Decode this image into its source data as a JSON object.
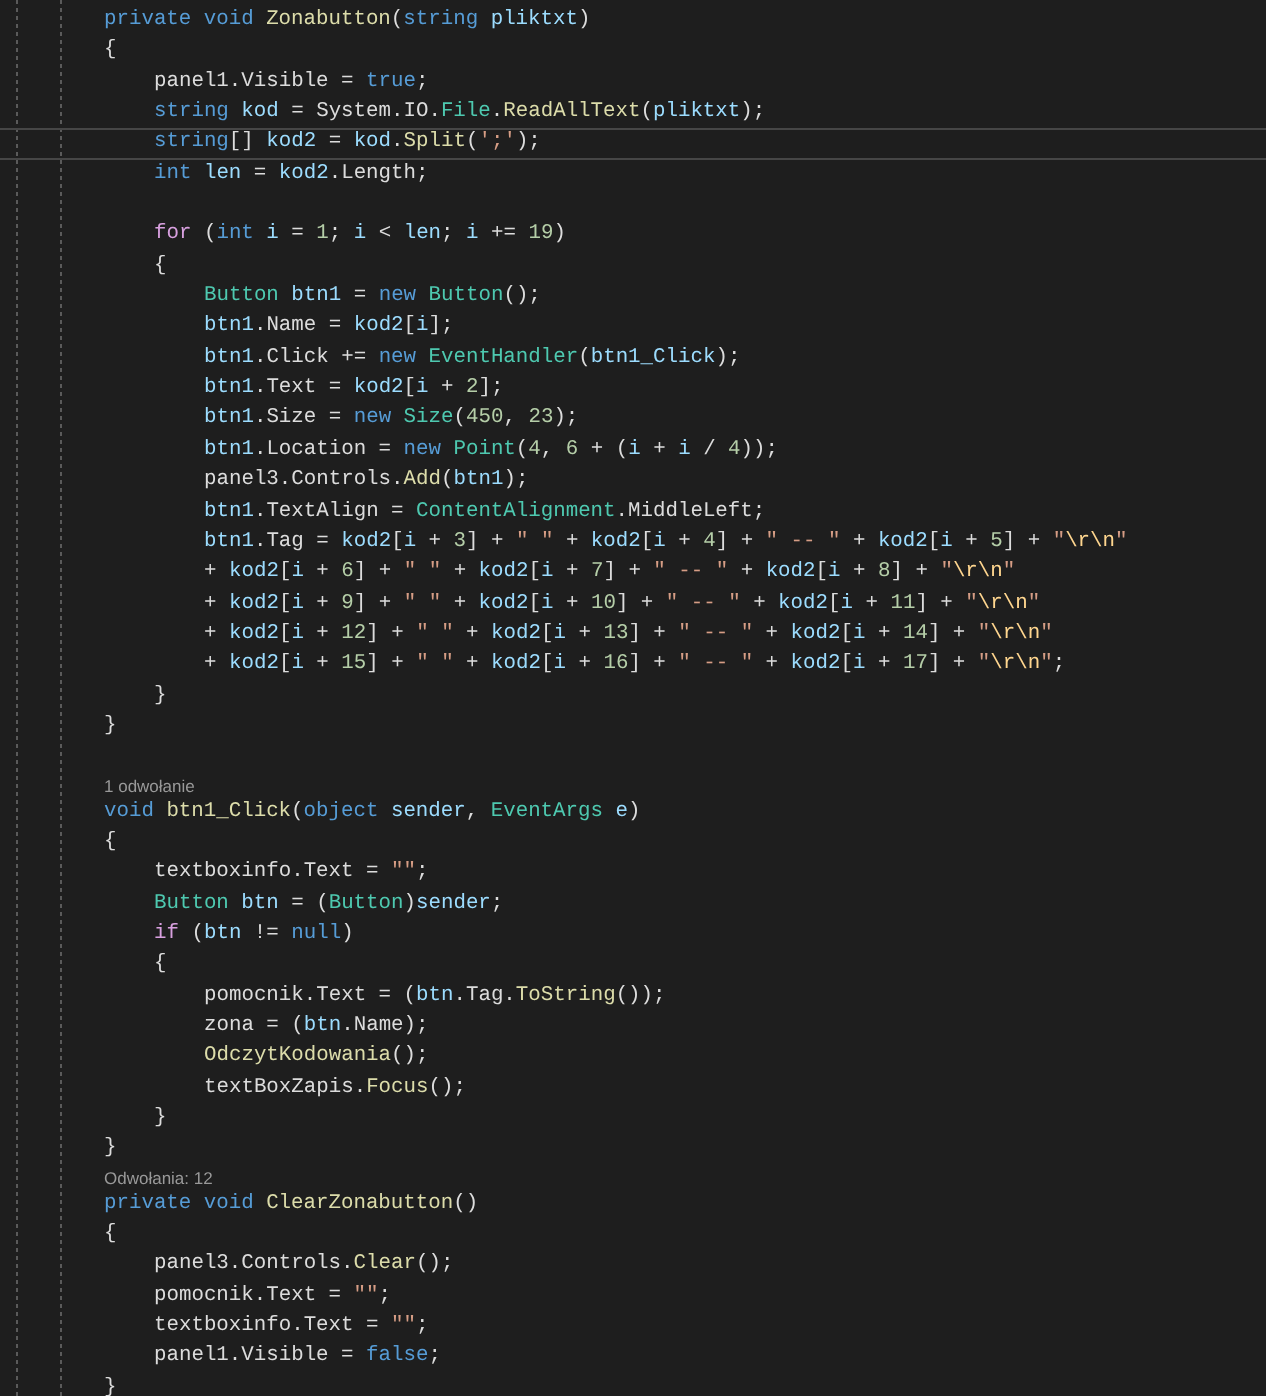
{
  "lines": [
    {
      "kind": "code",
      "current": false,
      "tokens": [
        {
          "text": "private void ",
          "kind": "kw"
        },
        {
          "text": "Zonabutton",
          "kind": "method"
        },
        {
          "text": "(",
          "kind": "p"
        },
        {
          "text": "string ",
          "kind": "kw"
        },
        {
          "text": "pliktxt",
          "kind": "var"
        },
        {
          "text": ")",
          "kind": "p"
        }
      ]
    },
    {
      "kind": "code",
      "current": false,
      "tokens": [
        {
          "text": "{",
          "kind": "p"
        }
      ],
      "children": [
        {
          "kind": "code",
          "current": false,
          "tokens": [
            {
              "text": "panel1.Visible = ",
              "kind": "p"
            },
            {
              "text": "true",
              "kind": "kw"
            },
            {
              "text": ";",
              "kind": "p"
            }
          ]
        },
        {
          "kind": "code",
          "current": false,
          "tokens": [
            {
              "text": "string ",
              "kind": "kw"
            },
            {
              "text": "kod",
              "kind": "var"
            },
            {
              "text": " = System.IO.",
              "kind": "p"
            },
            {
              "text": "File",
              "kind": "type"
            },
            {
              "text": ".",
              "kind": "p"
            },
            {
              "text": "ReadAllText",
              "kind": "method"
            },
            {
              "text": "(",
              "kind": "p"
            },
            {
              "text": "pliktxt",
              "kind": "var"
            },
            {
              "text": ");",
              "kind": "p"
            }
          ]
        },
        {
          "kind": "code",
          "current": true,
          "tokens": [
            {
              "text": "string",
              "kind": "kw"
            },
            {
              "text": "[] ",
              "kind": "p"
            },
            {
              "text": "kod2",
              "kind": "var"
            },
            {
              "text": " = ",
              "kind": "p"
            },
            {
              "text": "kod",
              "kind": "var"
            },
            {
              "text": ".",
              "kind": "p"
            },
            {
              "text": "Split",
              "kind": "method"
            },
            {
              "text": "(",
              "kind": "p"
            },
            {
              "text": "';'",
              "kind": "str"
            },
            {
              "text": ");",
              "kind": "p"
            }
          ]
        },
        {
          "kind": "code",
          "current": false,
          "tokens": [
            {
              "text": "int ",
              "kind": "kw"
            },
            {
              "text": "len",
              "kind": "var"
            },
            {
              "text": " = ",
              "kind": "p"
            },
            {
              "text": "kod2",
              "kind": "var"
            },
            {
              "text": ".Length;",
              "kind": "p"
            }
          ]
        },
        {
          "kind": "blank"
        },
        {
          "kind": "code",
          "current": false,
          "tokens": [
            {
              "text": "for",
              "kind": "ctrl"
            },
            {
              "text": " (",
              "kind": "p"
            },
            {
              "text": "int ",
              "kind": "kw"
            },
            {
              "text": "i",
              "kind": "var"
            },
            {
              "text": " = ",
              "kind": "p"
            },
            {
              "text": "1",
              "kind": "num"
            },
            {
              "text": "; ",
              "kind": "p"
            },
            {
              "text": "i",
              "kind": "var"
            },
            {
              "text": " < ",
              "kind": "p"
            },
            {
              "text": "len",
              "kind": "var"
            },
            {
              "text": "; ",
              "kind": "p"
            },
            {
              "text": "i",
              "kind": "var"
            },
            {
              "text": " += ",
              "kind": "p"
            },
            {
              "text": "19",
              "kind": "num"
            },
            {
              "text": ")",
              "kind": "p"
            }
          ]
        },
        {
          "kind": "code",
          "current": false,
          "tokens": [
            {
              "text": "{",
              "kind": "p"
            }
          ],
          "children": [
            {
              "kind": "code",
              "current": false,
              "tokens": [
                {
                  "text": "Button ",
                  "kind": "type"
                },
                {
                  "text": "btn1",
                  "kind": "var"
                },
                {
                  "text": " = ",
                  "kind": "p"
                },
                {
                  "text": "new ",
                  "kind": "kw"
                },
                {
                  "text": "Button",
                  "kind": "type"
                },
                {
                  "text": "();",
                  "kind": "p"
                }
              ]
            },
            {
              "kind": "code",
              "current": false,
              "tokens": [
                {
                  "text": "btn1",
                  "kind": "var"
                },
                {
                  "text": ".Name = ",
                  "kind": "p"
                },
                {
                  "text": "kod2",
                  "kind": "var"
                },
                {
                  "text": "[",
                  "kind": "p"
                },
                {
                  "text": "i",
                  "kind": "var"
                },
                {
                  "text": "];",
                  "kind": "p"
                }
              ]
            },
            {
              "kind": "code",
              "current": false,
              "tokens": [
                {
                  "text": "btn1",
                  "kind": "var"
                },
                {
                  "text": ".Click += ",
                  "kind": "p"
                },
                {
                  "text": "new ",
                  "kind": "kw"
                },
                {
                  "text": "EventHandler",
                  "kind": "type"
                },
                {
                  "text": "(",
                  "kind": "p"
                },
                {
                  "text": "btn1_Click",
                  "kind": "var"
                },
                {
                  "text": ");",
                  "kind": "p"
                }
              ]
            },
            {
              "kind": "code",
              "current": false,
              "tokens": [
                {
                  "text": "btn1",
                  "kind": "var"
                },
                {
                  "text": ".Text = ",
                  "kind": "p"
                },
                {
                  "text": "kod2",
                  "kind": "var"
                },
                {
                  "text": "[",
                  "kind": "p"
                },
                {
                  "text": "i",
                  "kind": "var"
                },
                {
                  "text": " + ",
                  "kind": "p"
                },
                {
                  "text": "2",
                  "kind": "num"
                },
                {
                  "text": "];",
                  "kind": "p"
                }
              ]
            },
            {
              "kind": "code",
              "current": false,
              "tokens": [
                {
                  "text": "btn1",
                  "kind": "var"
                },
                {
                  "text": ".Size = ",
                  "kind": "p"
                },
                {
                  "text": "new ",
                  "kind": "kw"
                },
                {
                  "text": "Size",
                  "kind": "type"
                },
                {
                  "text": "(",
                  "kind": "p"
                },
                {
                  "text": "450",
                  "kind": "num"
                },
                {
                  "text": ", ",
                  "kind": "p"
                },
                {
                  "text": "23",
                  "kind": "num"
                },
                {
                  "text": ");",
                  "kind": "p"
                }
              ]
            },
            {
              "kind": "code",
              "current": false,
              "tokens": [
                {
                  "text": "btn1",
                  "kind": "var"
                },
                {
                  "text": ".Location = ",
                  "kind": "p"
                },
                {
                  "text": "new ",
                  "kind": "kw"
                },
                {
                  "text": "Point",
                  "kind": "type"
                },
                {
                  "text": "(",
                  "kind": "p"
                },
                {
                  "text": "4",
                  "kind": "num"
                },
                {
                  "text": ", ",
                  "kind": "p"
                },
                {
                  "text": "6",
                  "kind": "num"
                },
                {
                  "text": " + (",
                  "kind": "p"
                },
                {
                  "text": "i",
                  "kind": "var"
                },
                {
                  "text": " + ",
                  "kind": "p"
                },
                {
                  "text": "i",
                  "kind": "var"
                },
                {
                  "text": " / ",
                  "kind": "p"
                },
                {
                  "text": "4",
                  "kind": "num"
                },
                {
                  "text": "));",
                  "kind": "p"
                }
              ]
            },
            {
              "kind": "code",
              "current": false,
              "tokens": [
                {
                  "text": "panel3.Controls.",
                  "kind": "p"
                },
                {
                  "text": "Add",
                  "kind": "method"
                },
                {
                  "text": "(",
                  "kind": "p"
                },
                {
                  "text": "btn1",
                  "kind": "var"
                },
                {
                  "text": ");",
                  "kind": "p"
                }
              ]
            },
            {
              "kind": "code",
              "current": false,
              "tokens": [
                {
                  "text": "btn1",
                  "kind": "var"
                },
                {
                  "text": ".TextAlign = ",
                  "kind": "p"
                },
                {
                  "text": "ContentAlignment",
                  "kind": "type"
                },
                {
                  "text": ".MiddleLeft;",
                  "kind": "p"
                }
              ]
            },
            {
              "kind": "code",
              "current": false,
              "tokens": [
                {
                  "text": "btn1",
                  "kind": "var"
                },
                {
                  "text": ".Tag = ",
                  "kind": "p"
                },
                {
                  "text": "kod2",
                  "kind": "var"
                },
                {
                  "text": "[",
                  "kind": "p"
                },
                {
                  "text": "i",
                  "kind": "var"
                },
                {
                  "text": " + ",
                  "kind": "p"
                },
                {
                  "text": "3",
                  "kind": "num"
                },
                {
                  "text": "] + ",
                  "kind": "p"
                },
                {
                  "text": "\" \"",
                  "kind": "str"
                },
                {
                  "text": " + ",
                  "kind": "p"
                },
                {
                  "text": "kod2",
                  "kind": "var"
                },
                {
                  "text": "[",
                  "kind": "p"
                },
                {
                  "text": "i",
                  "kind": "var"
                },
                {
                  "text": " + ",
                  "kind": "p"
                },
                {
                  "text": "4",
                  "kind": "num"
                },
                {
                  "text": "] + ",
                  "kind": "p"
                },
                {
                  "text": "\" -- \"",
                  "kind": "str"
                },
                {
                  "text": " + ",
                  "kind": "p"
                },
                {
                  "text": "kod2",
                  "kind": "var"
                },
                {
                  "text": "[",
                  "kind": "p"
                },
                {
                  "text": "i",
                  "kind": "var"
                },
                {
                  "text": " + ",
                  "kind": "p"
                },
                {
                  "text": "5",
                  "kind": "num"
                },
                {
                  "text": "] + ",
                  "kind": "p"
                },
                {
                  "text": "\"",
                  "kind": "str"
                },
                {
                  "text": "\\r\\n",
                  "kind": "esc"
                },
                {
                  "text": "\"",
                  "kind": "str"
                }
              ]
            },
            {
              "kind": "code",
              "current": false,
              "tokens": [
                {
                  "text": "+ ",
                  "kind": "p"
                },
                {
                  "text": "kod2",
                  "kind": "var"
                },
                {
                  "text": "[",
                  "kind": "p"
                },
                {
                  "text": "i",
                  "kind": "var"
                },
                {
                  "text": " + ",
                  "kind": "p"
                },
                {
                  "text": "6",
                  "kind": "num"
                },
                {
                  "text": "] + ",
                  "kind": "p"
                },
                {
                  "text": "\" \"",
                  "kind": "str"
                },
                {
                  "text": " + ",
                  "kind": "p"
                },
                {
                  "text": "kod2",
                  "kind": "var"
                },
                {
                  "text": "[",
                  "kind": "p"
                },
                {
                  "text": "i",
                  "kind": "var"
                },
                {
                  "text": " + ",
                  "kind": "p"
                },
                {
                  "text": "7",
                  "kind": "num"
                },
                {
                  "text": "] + ",
                  "kind": "p"
                },
                {
                  "text": "\" -- \"",
                  "kind": "str"
                },
                {
                  "text": " + ",
                  "kind": "p"
                },
                {
                  "text": "kod2",
                  "kind": "var"
                },
                {
                  "text": "[",
                  "kind": "p"
                },
                {
                  "text": "i",
                  "kind": "var"
                },
                {
                  "text": " + ",
                  "kind": "p"
                },
                {
                  "text": "8",
                  "kind": "num"
                },
                {
                  "text": "] + ",
                  "kind": "p"
                },
                {
                  "text": "\"",
                  "kind": "str"
                },
                {
                  "text": "\\r\\n",
                  "kind": "esc"
                },
                {
                  "text": "\"",
                  "kind": "str"
                }
              ]
            },
            {
              "kind": "code",
              "current": false,
              "tokens": [
                {
                  "text": "+ ",
                  "kind": "p"
                },
                {
                  "text": "kod2",
                  "kind": "var"
                },
                {
                  "text": "[",
                  "kind": "p"
                },
                {
                  "text": "i",
                  "kind": "var"
                },
                {
                  "text": " + ",
                  "kind": "p"
                },
                {
                  "text": "9",
                  "kind": "num"
                },
                {
                  "text": "] + ",
                  "kind": "p"
                },
                {
                  "text": "\" \"",
                  "kind": "str"
                },
                {
                  "text": " + ",
                  "kind": "p"
                },
                {
                  "text": "kod2",
                  "kind": "var"
                },
                {
                  "text": "[",
                  "kind": "p"
                },
                {
                  "text": "i",
                  "kind": "var"
                },
                {
                  "text": " + ",
                  "kind": "p"
                },
                {
                  "text": "10",
                  "kind": "num"
                },
                {
                  "text": "] + ",
                  "kind": "p"
                },
                {
                  "text": "\" -- \"",
                  "kind": "str"
                },
                {
                  "text": " + ",
                  "kind": "p"
                },
                {
                  "text": "kod2",
                  "kind": "var"
                },
                {
                  "text": "[",
                  "kind": "p"
                },
                {
                  "text": "i",
                  "kind": "var"
                },
                {
                  "text": " + ",
                  "kind": "p"
                },
                {
                  "text": "11",
                  "kind": "num"
                },
                {
                  "text": "] + ",
                  "kind": "p"
                },
                {
                  "text": "\"",
                  "kind": "str"
                },
                {
                  "text": "\\r\\n",
                  "kind": "esc"
                },
                {
                  "text": "\"",
                  "kind": "str"
                }
              ]
            },
            {
              "kind": "code",
              "current": false,
              "tokens": [
                {
                  "text": "+ ",
                  "kind": "p"
                },
                {
                  "text": "kod2",
                  "kind": "var"
                },
                {
                  "text": "[",
                  "kind": "p"
                },
                {
                  "text": "i",
                  "kind": "var"
                },
                {
                  "text": " + ",
                  "kind": "p"
                },
                {
                  "text": "12",
                  "kind": "num"
                },
                {
                  "text": "] + ",
                  "kind": "p"
                },
                {
                  "text": "\" \"",
                  "kind": "str"
                },
                {
                  "text": " + ",
                  "kind": "p"
                },
                {
                  "text": "kod2",
                  "kind": "var"
                },
                {
                  "text": "[",
                  "kind": "p"
                },
                {
                  "text": "i",
                  "kind": "var"
                },
                {
                  "text": " + ",
                  "kind": "p"
                },
                {
                  "text": "13",
                  "kind": "num"
                },
                {
                  "text": "] + ",
                  "kind": "p"
                },
                {
                  "text": "\" -- \"",
                  "kind": "str"
                },
                {
                  "text": " + ",
                  "kind": "p"
                },
                {
                  "text": "kod2",
                  "kind": "var"
                },
                {
                  "text": "[",
                  "kind": "p"
                },
                {
                  "text": "i",
                  "kind": "var"
                },
                {
                  "text": " + ",
                  "kind": "p"
                },
                {
                  "text": "14",
                  "kind": "num"
                },
                {
                  "text": "] + ",
                  "kind": "p"
                },
                {
                  "text": "\"",
                  "kind": "str"
                },
                {
                  "text": "\\r\\n",
                  "kind": "esc"
                },
                {
                  "text": "\"",
                  "kind": "str"
                }
              ]
            },
            {
              "kind": "code",
              "current": false,
              "tokens": [
                {
                  "text": "+ ",
                  "kind": "p"
                },
                {
                  "text": "kod2",
                  "kind": "var"
                },
                {
                  "text": "[",
                  "kind": "p"
                },
                {
                  "text": "i",
                  "kind": "var"
                },
                {
                  "text": " + ",
                  "kind": "p"
                },
                {
                  "text": "15",
                  "kind": "num"
                },
                {
                  "text": "] + ",
                  "kind": "p"
                },
                {
                  "text": "\" \"",
                  "kind": "str"
                },
                {
                  "text": " + ",
                  "kind": "p"
                },
                {
                  "text": "kod2",
                  "kind": "var"
                },
                {
                  "text": "[",
                  "kind": "p"
                },
                {
                  "text": "i",
                  "kind": "var"
                },
                {
                  "text": " + ",
                  "kind": "p"
                },
                {
                  "text": "16",
                  "kind": "num"
                },
                {
                  "text": "] + ",
                  "kind": "p"
                },
                {
                  "text": "\" -- \"",
                  "kind": "str"
                },
                {
                  "text": " + ",
                  "kind": "p"
                },
                {
                  "text": "kod2",
                  "kind": "var"
                },
                {
                  "text": "[",
                  "kind": "p"
                },
                {
                  "text": "i",
                  "kind": "var"
                },
                {
                  "text": " + ",
                  "kind": "p"
                },
                {
                  "text": "17",
                  "kind": "num"
                },
                {
                  "text": "] + ",
                  "kind": "p"
                },
                {
                  "text": "\"",
                  "kind": "str"
                },
                {
                  "text": "\\r\\n",
                  "kind": "esc"
                },
                {
                  "text": "\"",
                  "kind": "str"
                },
                {
                  "text": ";",
                  "kind": "p"
                }
              ]
            }
          ]
        },
        {
          "kind": "code",
          "current": false,
          "tokens": [
            {
              "text": "}",
              "kind": "p"
            }
          ]
        }
      ]
    },
    {
      "kind": "code",
      "current": false,
      "tokens": [
        {
          "text": "}",
          "kind": "p"
        }
      ]
    },
    {
      "kind": "blank"
    },
    {
      "kind": "lens",
      "text": "1 odwołanie"
    },
    {
      "kind": "code",
      "current": false,
      "tokens": [
        {
          "text": "void ",
          "kind": "kw"
        },
        {
          "text": "btn1_Click",
          "kind": "method"
        },
        {
          "text": "(",
          "kind": "p"
        },
        {
          "text": "object ",
          "kind": "kw"
        },
        {
          "text": "sender",
          "kind": "var"
        },
        {
          "text": ", ",
          "kind": "p"
        },
        {
          "text": "EventArgs ",
          "kind": "type"
        },
        {
          "text": "e",
          "kind": "var"
        },
        {
          "text": ")",
          "kind": "p"
        }
      ]
    },
    {
      "kind": "code",
      "current": false,
      "tokens": [
        {
          "text": "{",
          "kind": "p"
        }
      ],
      "children": [
        {
          "kind": "code",
          "current": false,
          "tokens": [
            {
              "text": "textboxinfo.Text = ",
              "kind": "p"
            },
            {
              "text": "\"\"",
              "kind": "str"
            },
            {
              "text": ";",
              "kind": "p"
            }
          ]
        },
        {
          "kind": "code",
          "current": false,
          "tokens": [
            {
              "text": "Button ",
              "kind": "type"
            },
            {
              "text": "btn",
              "kind": "var"
            },
            {
              "text": " = (",
              "kind": "p"
            },
            {
              "text": "Button",
              "kind": "type"
            },
            {
              "text": ")",
              "kind": "p"
            },
            {
              "text": "sender",
              "kind": "var"
            },
            {
              "text": ";",
              "kind": "p"
            }
          ]
        },
        {
          "kind": "code",
          "current": false,
          "tokens": [
            {
              "text": "if",
              "kind": "ctrl"
            },
            {
              "text": " (",
              "kind": "p"
            },
            {
              "text": "btn",
              "kind": "var"
            },
            {
              "text": " != ",
              "kind": "p"
            },
            {
              "text": "null",
              "kind": "kw"
            },
            {
              "text": ")",
              "kind": "p"
            }
          ]
        },
        {
          "kind": "code",
          "current": false,
          "tokens": [
            {
              "text": "{",
              "kind": "p"
            }
          ],
          "children": [
            {
              "kind": "code",
              "current": false,
              "tokens": [
                {
                  "text": "pomocnik.Text = (",
                  "kind": "p"
                },
                {
                  "text": "btn",
                  "kind": "var"
                },
                {
                  "text": ".Tag.",
                  "kind": "p"
                },
                {
                  "text": "ToString",
                  "kind": "method"
                },
                {
                  "text": "());",
                  "kind": "p"
                }
              ]
            },
            {
              "kind": "code",
              "current": false,
              "tokens": [
                {
                  "text": "zona = (",
                  "kind": "p"
                },
                {
                  "text": "btn",
                  "kind": "var"
                },
                {
                  "text": ".Name);",
                  "kind": "p"
                }
              ]
            },
            {
              "kind": "code",
              "current": false,
              "tokens": [
                {
                  "text": "OdczytKodowania",
                  "kind": "method"
                },
                {
                  "text": "();",
                  "kind": "p"
                }
              ]
            },
            {
              "kind": "code",
              "current": false,
              "tokens": [
                {
                  "text": "textBoxZapis.",
                  "kind": "p"
                },
                {
                  "text": "Focus",
                  "kind": "method"
                },
                {
                  "text": "();",
                  "kind": "p"
                }
              ]
            }
          ]
        },
        {
          "kind": "code",
          "current": false,
          "tokens": [
            {
              "text": "}",
              "kind": "p"
            }
          ]
        }
      ]
    },
    {
      "kind": "code",
      "current": false,
      "tokens": [
        {
          "text": "}",
          "kind": "p"
        }
      ]
    },
    {
      "kind": "lens",
      "text": "Odwołania: 12"
    },
    {
      "kind": "code",
      "current": false,
      "tokens": [
        {
          "text": "private void ",
          "kind": "kw"
        },
        {
          "text": "ClearZonabutton",
          "kind": "method"
        },
        {
          "text": "()",
          "kind": "p"
        }
      ]
    },
    {
      "kind": "code",
      "current": false,
      "tokens": [
        {
          "text": "{",
          "kind": "p"
        }
      ],
      "children": [
        {
          "kind": "code",
          "current": false,
          "tokens": [
            {
              "text": "panel3.Controls.",
              "kind": "p"
            },
            {
              "text": "Clear",
              "kind": "method"
            },
            {
              "text": "();",
              "kind": "p"
            }
          ]
        },
        {
          "kind": "code",
          "current": false,
          "tokens": [
            {
              "text": "pomocnik.Text = ",
              "kind": "p"
            },
            {
              "text": "\"\"",
              "kind": "str"
            },
            {
              "text": ";",
              "kind": "p"
            }
          ]
        },
        {
          "kind": "code",
          "current": false,
          "tokens": [
            {
              "text": "textboxinfo.Text = ",
              "kind": "p"
            },
            {
              "text": "\"\"",
              "kind": "str"
            },
            {
              "text": ";",
              "kind": "p"
            }
          ]
        },
        {
          "kind": "code",
          "current": false,
          "tokens": [
            {
              "text": "panel1.Visible = ",
              "kind": "p"
            },
            {
              "text": "false",
              "kind": "kw"
            },
            {
              "text": ";",
              "kind": "p"
            }
          ]
        }
      ]
    },
    {
      "kind": "code",
      "current": false,
      "tokens": [
        {
          "text": "}",
          "kind": "p"
        }
      ]
    }
  ]
}
